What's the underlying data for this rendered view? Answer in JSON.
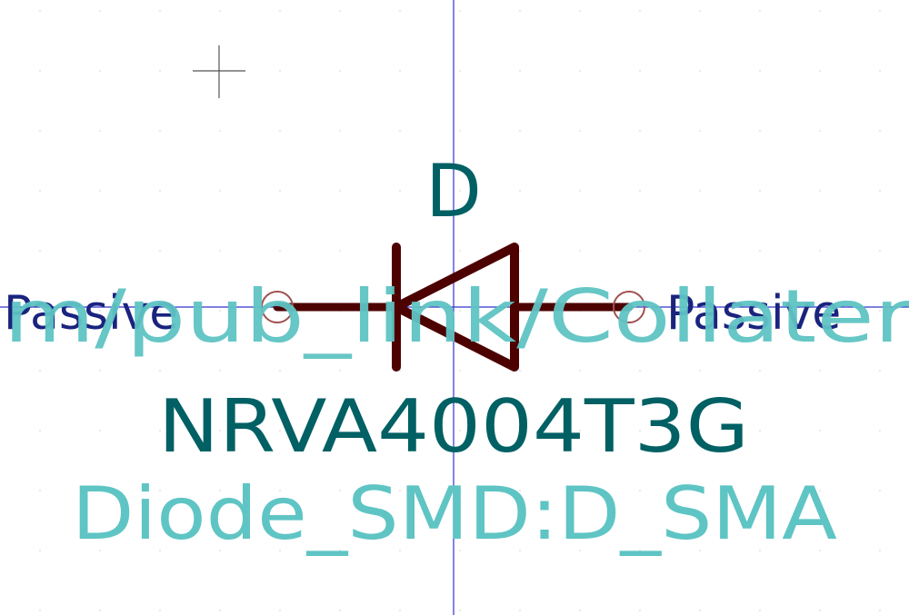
{
  "component": {
    "reference": "D",
    "value": "NRVA4004T3G",
    "footprint": "Diode_SMD:D_SMA",
    "link_fragment": "m/pub_link/Collater"
  },
  "pins": {
    "left_type": "Passive",
    "right_type": "Passive"
  },
  "colors": {
    "background": "#ffffff",
    "body": "#4d0000",
    "reference_value": "#006064",
    "footprint": "#5fc4c4",
    "pin_type": "#1a237e",
    "pin_circle": "#a05050",
    "axis": "#3333cc",
    "grid": "#d9d9d9"
  }
}
